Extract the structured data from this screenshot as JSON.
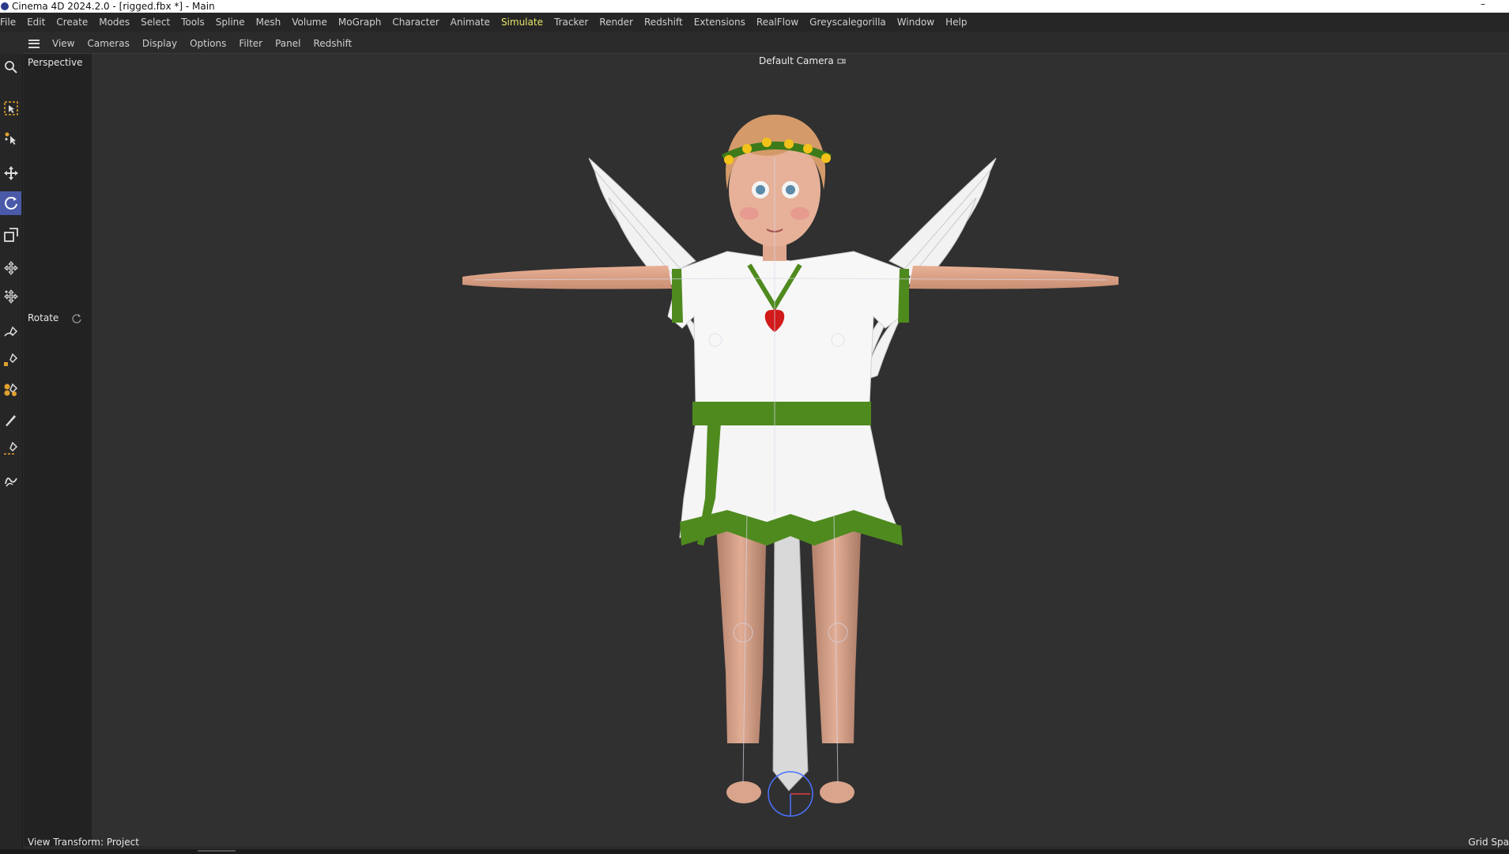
{
  "window": {
    "title": "Cinema 4D 2024.2.0 - [rigged.fbx *] - Main",
    "minimize_glyph": "–"
  },
  "main_menu": {
    "items": [
      "File",
      "Edit",
      "Create",
      "Modes",
      "Select",
      "Tools",
      "Spline",
      "Mesh",
      "Volume",
      "MoGraph",
      "Character",
      "Animate",
      "Simulate",
      "Tracker",
      "Render",
      "Redshift",
      "Extensions",
      "RealFlow",
      "Greyscalegorilla",
      "Window",
      "Help"
    ],
    "active": "Simulate"
  },
  "viewport_menu": {
    "items": [
      "View",
      "Cameras",
      "Display",
      "Options",
      "Filter",
      "Panel",
      "Redshift"
    ]
  },
  "viewport": {
    "projection_label": "Perspective",
    "camera_label": "Default Camera",
    "tool_label": "Rotate",
    "view_transform": "View Transform: Project",
    "grid_label": "Grid Spa"
  },
  "toolbar": {
    "tools": [
      {
        "name": "search-icon"
      },
      {
        "name": "live-selection-icon"
      },
      {
        "name": "selection-tweak-icon"
      },
      {
        "name": "move-icon"
      },
      {
        "name": "rotate-icon",
        "active": true
      },
      {
        "name": "scale-icon"
      },
      {
        "name": "transform-icon"
      },
      {
        "name": "axis-transform-icon"
      },
      {
        "name": "pen-icon"
      },
      {
        "name": "spline-pen-icon"
      },
      {
        "name": "sculpt-icon"
      },
      {
        "name": "brush-icon"
      },
      {
        "name": "knife-icon"
      },
      {
        "name": "spline-sketch-icon"
      }
    ]
  },
  "colors": {
    "menu_active": "#e8e66a",
    "tool_active": "#4a5aa8",
    "viewport_bg": "#303030",
    "dress_green": "#4f8a1f"
  }
}
